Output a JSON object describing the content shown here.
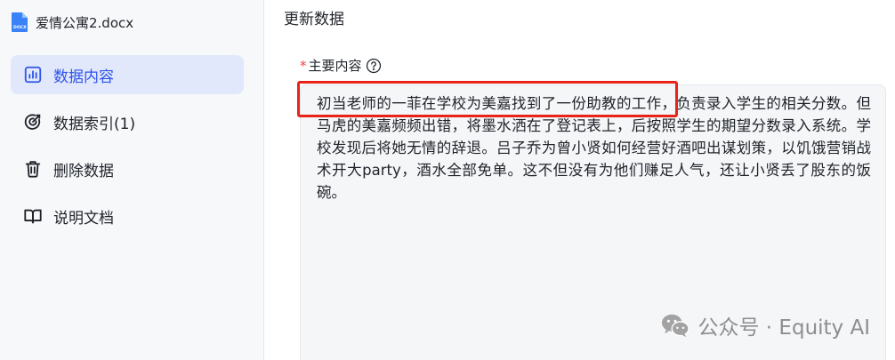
{
  "file": {
    "name": "爱情公寓2.docx",
    "icon": "docx-file-icon",
    "icon_text": "DOCX",
    "icon_color": "#3b82f6"
  },
  "sidebar": {
    "items": [
      {
        "label": "数据内容",
        "icon": "bar-chart-icon",
        "active": true
      },
      {
        "label": "数据索引(1)",
        "icon": "target-icon",
        "active": false
      },
      {
        "label": "删除数据",
        "icon": "trash-icon",
        "active": false
      },
      {
        "label": "说明文档",
        "icon": "book-icon",
        "active": false
      }
    ],
    "active_color": "#2f54eb",
    "active_bg": "#e1e8fb"
  },
  "main": {
    "title": "更新数据",
    "field": {
      "required_mark": "*",
      "label": "主要内容",
      "help_icon": "question-circle-icon",
      "value": "初当老师的一菲在学校为美嘉找到了一份助教的工作，负责录入学生的相关分数。但马虎的美嘉频频出错，将墨水洒在了登记表上，后按照学生的期望分数录入系统。学校发现后将她无情的辞退。吕子乔为曾小贤如何经营好酒吧出谋划策，以饥饿营销战术开大party，酒水全部免单。这不但没有为他们赚足人气，还让小贤丢了股东的饭碗。"
    },
    "annotation_color": "#e8231a"
  },
  "watermark": {
    "icon": "wechat-icon",
    "text": "公众号 · Equity AI"
  }
}
